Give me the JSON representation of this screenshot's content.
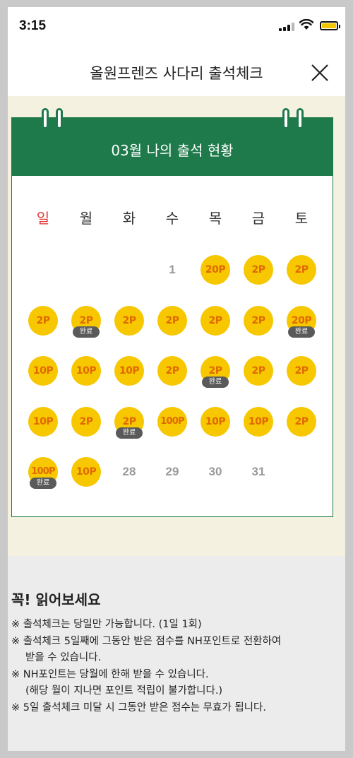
{
  "status": {
    "time": "3:15"
  },
  "header": {
    "title": "올원프렌즈 사다리 출석체크",
    "close_icon": "close-icon"
  },
  "calendar": {
    "title": "03월 나의 출석 현황",
    "weekdays": [
      "일",
      "월",
      "화",
      "수",
      "목",
      "금",
      "토"
    ],
    "weekday_colors": {
      "sunday": "#e03a3a",
      "default": "#333333"
    },
    "complete_label": "완료",
    "rows": [
      [
        null,
        null,
        null,
        {
          "day": "1"
        },
        {
          "points": "20P"
        },
        {
          "points": "2P"
        },
        {
          "points": "2P"
        }
      ],
      [
        {
          "points": "2P"
        },
        {
          "points": "2P",
          "done": true
        },
        {
          "points": "2P"
        },
        {
          "points": "2P"
        },
        {
          "points": "2P"
        },
        {
          "points": "2P"
        },
        {
          "points": "20P",
          "done": true
        }
      ],
      [
        {
          "points": "10P"
        },
        {
          "points": "10P"
        },
        {
          "points": "10P"
        },
        {
          "points": "2P"
        },
        {
          "points": "2P",
          "done": true
        },
        {
          "points": "2P"
        },
        {
          "points": "2P"
        }
      ],
      [
        {
          "points": "10P"
        },
        {
          "points": "2P"
        },
        {
          "points": "2P",
          "done": true
        },
        {
          "points": "100P"
        },
        {
          "points": "10P"
        },
        {
          "points": "10P"
        },
        {
          "points": "2P"
        }
      ],
      [
        {
          "points": "100P",
          "done": true
        },
        {
          "points": "10P"
        },
        {
          "day": "28"
        },
        {
          "day": "29"
        },
        {
          "day": "30"
        },
        {
          "day": "31"
        },
        null
      ]
    ]
  },
  "notice": {
    "title": "꼭! 읽어보세요",
    "lines": [
      {
        "text": "※ 출석체크는 당일만 가능합니다. (1일 1회)",
        "indent": false
      },
      {
        "text": "※ 출석체크  5일째에 그동안 받은 점수를 NH포인트로 전환하여",
        "indent": false
      },
      {
        "text": "받을 수 있습니다.",
        "indent": true
      },
      {
        "text": "※ NH포인트는 당월에 한해 받을 수 있습니다.",
        "indent": false
      },
      {
        "text": "(해당 월이 지나면 포인트 적립이 불가합니다.)",
        "indent": true
      },
      {
        "text": "※ 5일 출석체크 미달 시 그동안 받은 점수는 무효가 됩니다.",
        "indent": false
      }
    ]
  },
  "colors": {
    "brand_green": "#1e7a4a",
    "coin_yellow": "#f7c700",
    "coin_text": "#e06a00",
    "cream": "#f4f1e0"
  }
}
